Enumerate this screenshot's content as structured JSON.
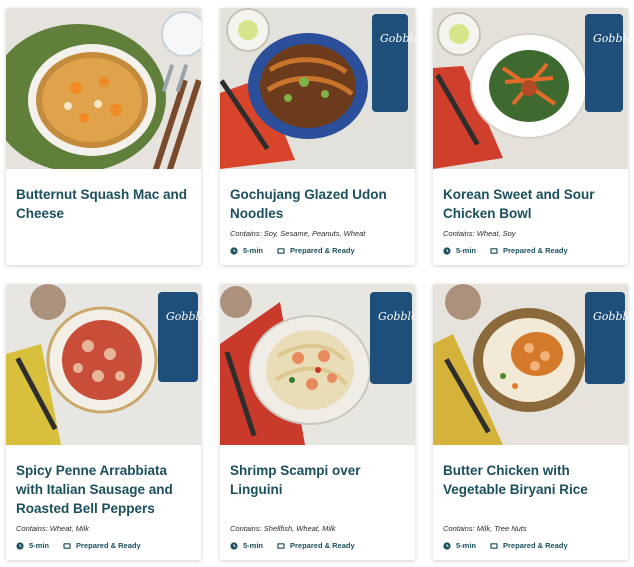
{
  "cards": [
    {
      "title": "Butternut Squash Mac and Cheese",
      "contains": "",
      "time": "",
      "prep": ""
    },
    {
      "title": "Gochujang Glazed Udon Noodles",
      "contains": "Contains: Soy, Sesame, Peanuts, Wheat",
      "time": "5-min",
      "prep": "Prepared & Ready"
    },
    {
      "title": "Korean Sweet and Sour Chicken Bowl",
      "contains": "Contains: Wheat, Soy",
      "time": "5-min",
      "prep": "Prepared & Ready"
    },
    {
      "title": "Spicy Penne Arrabbiata with Italian Sausage and Roasted Bell Peppers",
      "contains": "Contains: Wheat, Milk",
      "time": "5-min",
      "prep": "Prepared & Ready"
    },
    {
      "title": "Shrimp Scampi over Linguini",
      "contains": "Contains: Shellfish, Wheat, Milk",
      "time": "5-min",
      "prep": "Prepared & Ready"
    },
    {
      "title": "Butter Chicken with Vegetable Biryani Rice",
      "contains": "Contains: Milk, Tree Nuts",
      "time": "5-min",
      "prep": "Prepared & Ready"
    }
  ],
  "brand_label": "Gobble",
  "colors": {
    "title": "#1b4f5c",
    "text": "#2b2b2b",
    "box": "#1e4f7a"
  }
}
